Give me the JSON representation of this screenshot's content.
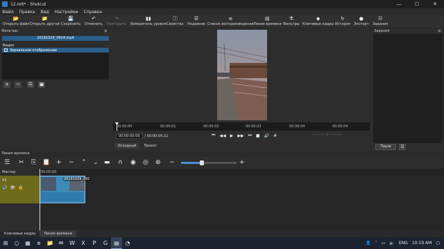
{
  "window": {
    "title": "12.mlt* - Shotcut",
    "minimize": "—",
    "maximize": "☐",
    "close": "✕"
  },
  "menu": [
    "Файл",
    "Правка",
    "Вид",
    "Настройки",
    "Справка"
  ],
  "toolbar": [
    {
      "label": "Открыть файл",
      "icon": "folder-icon",
      "glyph": "📂",
      "enabled": true
    },
    {
      "label": "Открыть другой",
      "icon": "folder-plus-icon",
      "glyph": "📁",
      "enabled": true
    },
    {
      "label": "Сохранить",
      "icon": "save-icon",
      "glyph": "💾",
      "enabled": true
    },
    {
      "label": "Отменить",
      "icon": "undo-icon",
      "glyph": "↶",
      "enabled": true
    },
    {
      "label": "Повторить",
      "icon": "redo-icon",
      "glyph": "↷",
      "enabled": false
    },
    {
      "label": "Измеритель уровня",
      "icon": "level-meter-icon",
      "glyph": "▮▮",
      "enabled": true
    },
    {
      "label": "Свойства",
      "icon": "properties-icon",
      "glyph": "ⓘ",
      "enabled": true
    },
    {
      "label": "Недавние",
      "icon": "recent-icon",
      "glyph": "☰",
      "enabled": true
    },
    {
      "label": "Список воспроизведения",
      "icon": "playlist-icon",
      "glyph": "≡",
      "enabled": true
    },
    {
      "label": "Линия времени",
      "icon": "timeline-icon",
      "glyph": "▤",
      "enabled": true
    },
    {
      "label": "Фильтры",
      "icon": "filters-icon",
      "glyph": "⚗",
      "enabled": true
    },
    {
      "label": "Ключевые кадры",
      "icon": "keyframes-icon",
      "glyph": "◆",
      "enabled": true
    },
    {
      "label": "История",
      "icon": "history-icon",
      "glyph": "↻",
      "enabled": true
    },
    {
      "label": "Экспорт",
      "icon": "export-icon",
      "glyph": "●",
      "enabled": true
    },
    {
      "label": "Задания",
      "icon": "jobs-icon",
      "glyph": "☷",
      "enabled": true
    }
  ],
  "filters": {
    "title": "Фильтры",
    "clip_name": "20191029_0924.mp4",
    "video_label": "Видео",
    "items": [
      {
        "label": "Зеркальное отображение",
        "checked": true
      }
    ],
    "buttons": [
      "+",
      "−",
      "⎘",
      "▣"
    ]
  },
  "player": {
    "ruler_ticks": [
      "00:00:00",
      "00:00:01",
      "00:00:02",
      "00:00:03",
      "00:00:04"
    ],
    "position": "00:00:00:00",
    "duration": "/ 00:00:05:22",
    "in_out": "--:--:--:-- /      --:--:--:--",
    "tabs": [
      "Исходный",
      "Проект"
    ]
  },
  "jobs": {
    "title": "Задания",
    "pause_label": "Пауза",
    "menu_label": "☰"
  },
  "timeline": {
    "title": "Линия времени",
    "tools": [
      "☰",
      "✂",
      "⎘",
      "📋",
      "+",
      "−",
      "⌃",
      "⌄",
      "▬",
      "∩",
      "◉",
      "◎",
      "⊛",
      "−",
      "+"
    ],
    "master_label": "Мастер",
    "ruler_tick": "00:00:00",
    "track_name": "V1",
    "track_icons": [
      "🔊",
      "👁",
      "🔒"
    ],
    "clip_label": "20191029_092"
  },
  "bottom_tabs": [
    "Ключевые кадры",
    "Линия времени"
  ],
  "taskbar": {
    "apps": [
      "⊞",
      "○",
      "▦",
      "e",
      "📁",
      "✉",
      "W",
      "X",
      "P",
      "G",
      "▤",
      "◔"
    ],
    "tray": {
      "lang": "ENG",
      "time": "10:19 AM"
    }
  }
}
